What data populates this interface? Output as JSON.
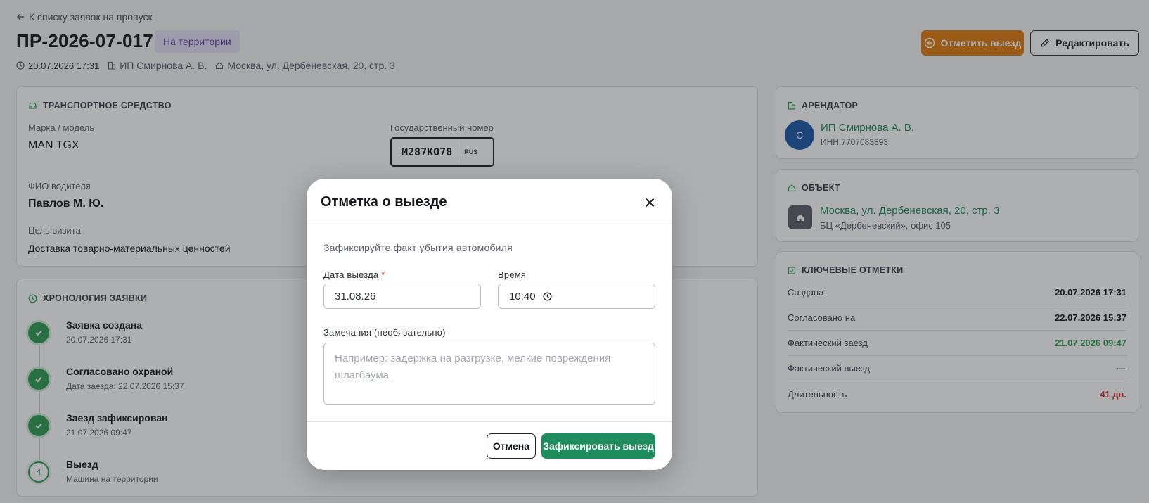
{
  "header": {
    "back_label": "К списку заявок на пропуск",
    "pass_id": "ПР-2026-07-017",
    "status_badge": "На территории",
    "created": "20.07.2026 17:31",
    "tenant": "ИП Смирнова А. В.",
    "address": "Москва, ул. Дербеневская, 20, стр. 3",
    "exit_button": "Отметить выезд",
    "edit_button": "Редактировать"
  },
  "vehicle": {
    "title": "ТРАНСПОРТНОЕ СРЕДСТВО",
    "model_label": "Марка / модель",
    "model_value": "MAN TGX",
    "plate_label": "Государственный номер",
    "plate_value": "М287КО78",
    "plate_region": "RUS",
    "driver_label": "ФИО водителя",
    "driver_value": "Павлов М. Ю.",
    "purpose_label": "Цель визита",
    "purpose_value": "Доставка товарно-материальных ценностей"
  },
  "timeline": {
    "title": "ХРОНОЛОГИЯ ЗАЯВКИ",
    "items": [
      {
        "title": "Заявка создана",
        "sub": "20.07.2026 17:31",
        "state": "done"
      },
      {
        "title": "Согласовано охраной",
        "sub": "Дата заезда: 22.07.2026 15:37",
        "state": "done"
      },
      {
        "title": "Заезд зафиксирован",
        "sub": "21.07.2026 09:47",
        "state": "done"
      },
      {
        "title": "Выезд",
        "sub": "Машина на территории",
        "state": "pending",
        "num": "4"
      }
    ]
  },
  "tenant_card": {
    "title": "АРЕНДАТОР",
    "avatar": "С",
    "name": "ИП Смирнова А. В.",
    "inn": "ИНН 7707083893"
  },
  "object_card": {
    "title": "ОБЪЕКТ",
    "address": "Москва, ул. Дербеневская, 20, стр. 3",
    "sub": "БЦ «Дербеневский», офис 105"
  },
  "marks_card": {
    "title": "КЛЮЧЕВЫЕ ОТМЕТКИ",
    "rows": [
      {
        "k": "Создана",
        "v": "20.07.2026 17:31",
        "tone": "normal"
      },
      {
        "k": "Согласовано на",
        "v": "22.07.2026 15:37",
        "tone": "normal"
      },
      {
        "k": "Фактический заезд",
        "v": "21.07.2026 09:47",
        "tone": "green"
      },
      {
        "k": "Фактический выезд",
        "v": "—",
        "tone": "normal"
      },
      {
        "k": "Длительность",
        "v": "41 дн.",
        "tone": "red"
      }
    ]
  },
  "modal": {
    "title": "Отметка о выезде",
    "hint": "Зафиксируйте факт убытия автомобиля",
    "date_label": "Дата выезда",
    "date_required": "*",
    "date_value": "31.08.26",
    "time_label": "Время",
    "time_value": "10:40",
    "notes_label": "Замечания (необязательно)",
    "notes_placeholder": "Например: задержка на разгрузке, мелкие повреждения шлагбаума",
    "cancel": "Отмена",
    "submit": "Зафиксировать выезд"
  },
  "colors": {
    "accent_green": "#1f8c5e",
    "accent_orange": "#e07c0d",
    "badge_bg": "#e6e1f5",
    "badge_text": "#5b3fa0",
    "link_green": "#1e8a55",
    "danger_red": "#d0342c",
    "avatar_blue": "#1e5aa8"
  }
}
